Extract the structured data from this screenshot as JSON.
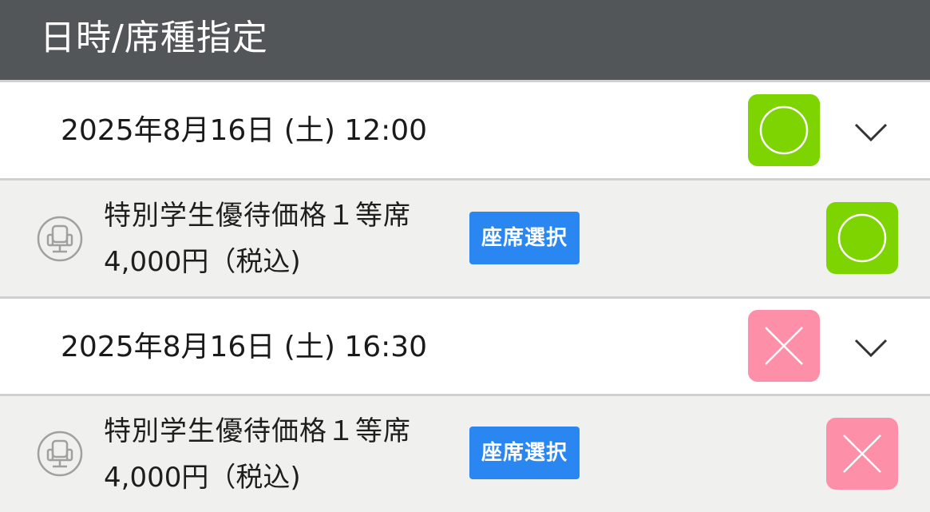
{
  "header": {
    "title": "日時/席種指定"
  },
  "performances": [
    {
      "date": "2025年8月16日 (土) 12:00",
      "status": "available",
      "status_color": "#7ed400",
      "status_icon": "circle-icon",
      "seat": {
        "name": "特別学生優待価格１等席",
        "price": "4,000円（税込)",
        "select_label": "座席選択",
        "status": "available",
        "status_color": "#7ed400",
        "status_icon": "circle-icon"
      }
    },
    {
      "date": "2025年8月16日 (土) 16:30",
      "status": "sold-out",
      "status_color": "#fd8fa9",
      "status_icon": "cross-icon",
      "seat": {
        "name": "特別学生優待価格１等席",
        "price": "4,000円（税込)",
        "select_label": "座席選択",
        "status": "sold-out",
        "status_color": "#fd8fa9",
        "status_icon": "cross-icon"
      }
    }
  ],
  "colors": {
    "header_bg": "#525659",
    "button_blue": "#2a86f0"
  }
}
